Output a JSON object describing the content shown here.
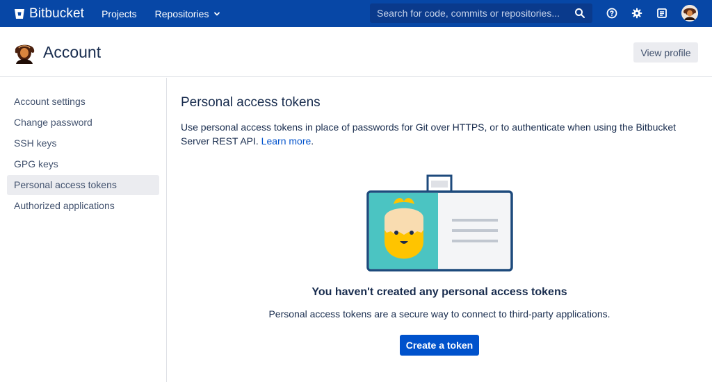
{
  "topnav": {
    "brand_name": "Bitbucket",
    "links": [
      {
        "label": "Projects"
      },
      {
        "label": "Repositories"
      }
    ],
    "search_placeholder": "Search for code, commits or repositories...",
    "icons": [
      "bitbucket-logo-icon",
      "chevron-down-icon",
      "search-icon",
      "help-icon",
      "gear-icon",
      "notes-icon",
      "avatar"
    ],
    "bg_color": "#0747a6"
  },
  "header": {
    "title": "Account",
    "view_profile_label": "View profile"
  },
  "sidebar": {
    "items": [
      {
        "label": "Account settings",
        "active": false
      },
      {
        "label": "Change password",
        "active": false
      },
      {
        "label": "SSH keys",
        "active": false
      },
      {
        "label": "GPG keys",
        "active": false
      },
      {
        "label": "Personal access tokens",
        "active": true
      },
      {
        "label": "Authorized applications",
        "active": false
      }
    ]
  },
  "main": {
    "title": "Personal access tokens",
    "description": "Use personal access tokens in place of passwords for Git over HTTPS, or to authenticate when using the Bitbucket Server REST API.",
    "learn_more_label": "Learn more",
    "description_end": ".",
    "empty_state": {
      "title": "You haven't created any personal access tokens",
      "description": "Personal access tokens are a secure way to connect to third-party applications.",
      "button_label": "Create a token"
    },
    "accent_color": "#0052cc"
  }
}
